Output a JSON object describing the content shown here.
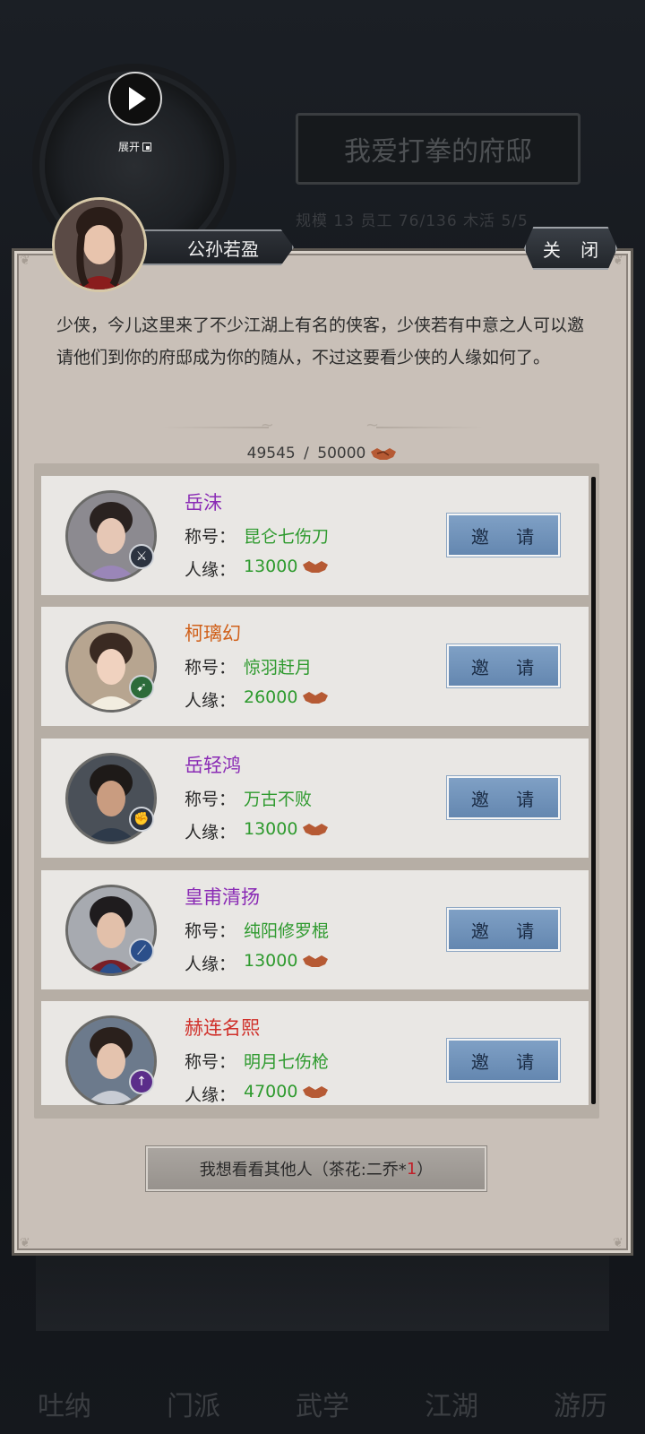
{
  "background": {
    "mansion_title": "我爱打拳的府邸",
    "stats_line": "规模 13   员工 76/136   木活 5/5",
    "nav": [
      "吐纳",
      "门派",
      "武学",
      "江湖",
      "游历"
    ]
  },
  "play_control": {
    "label": "展开",
    "icon": "play-icon"
  },
  "npc": {
    "name": "公孙若盈"
  },
  "close_label": "关 闭",
  "dialog_text": "少侠，今儿这里来了不少江湖上有名的侠客，少侠若有中意之人可以邀请他们到你的府邸成为你的随从，不过这要看少侠的人缘如何了。",
  "popularity": {
    "current": "49545",
    "max": "50000",
    "separator": " / "
  },
  "labels": {
    "title": "称号：",
    "popularity": "人缘："
  },
  "heroes": [
    {
      "name": "岳沫",
      "name_color": "#8a2bb5",
      "title": "昆仑七伤刀",
      "cost": "13000",
      "invite": "邀 请"
    },
    {
      "name": "柯璃幻",
      "name_color": "#d0601a",
      "title": "惊羽赶月",
      "cost": "26000",
      "invite": "邀 请"
    },
    {
      "name": "岳轻鸿",
      "name_color": "#8a2bb5",
      "title": "万古不败",
      "cost": "13000",
      "invite": "邀 请"
    },
    {
      "name": "皇甫清扬",
      "name_color": "#8a2bb5",
      "title": "纯阳修罗棍",
      "cost": "13000",
      "invite": "邀 请"
    },
    {
      "name": "赫连名熙",
      "name_color": "#d0302a",
      "title": "明月七伤枪",
      "cost": "47000",
      "invite": "邀 请"
    }
  ],
  "refresh": {
    "prefix": "我想看看其他人（茶花:二乔*",
    "count": "1",
    "suffix": "）"
  },
  "colors": {
    "panel_bg": "#c9c0b8",
    "invite_btn": "#7496bd",
    "green_value": "#2e9a2e"
  }
}
